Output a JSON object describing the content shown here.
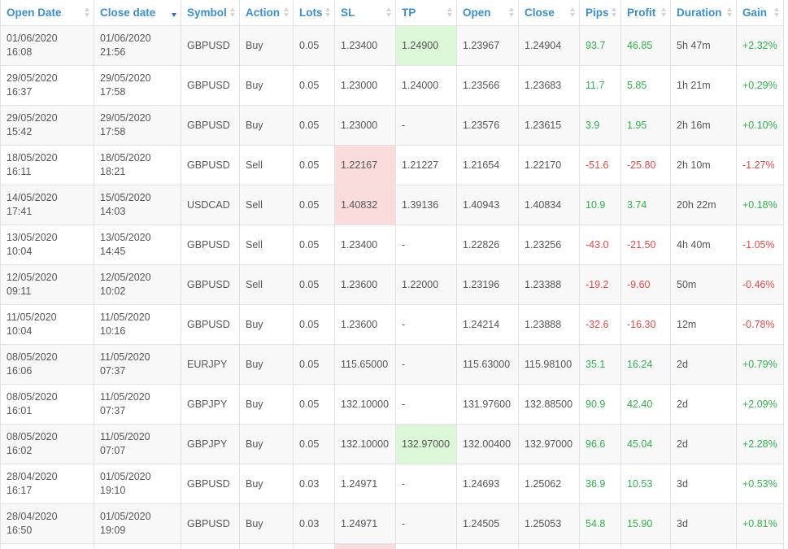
{
  "columns": [
    {
      "label": "Open Date",
      "sort": "none"
    },
    {
      "label": "Close date",
      "sort": "desc"
    },
    {
      "label": "Symbol",
      "sort": "none"
    },
    {
      "label": "Action",
      "sort": "none"
    },
    {
      "label": "Lots",
      "sort": "none"
    },
    {
      "label": "SL",
      "sort": "none"
    },
    {
      "label": "TP",
      "sort": "none"
    },
    {
      "label": "Open",
      "sort": "none"
    },
    {
      "label": "Close",
      "sort": "none"
    },
    {
      "label": "Pips",
      "sort": "none"
    },
    {
      "label": "Profit",
      "sort": "none"
    },
    {
      "label": "Duration",
      "sort": "none"
    },
    {
      "label": "Gain",
      "sort": "none"
    }
  ],
  "colors": {
    "header": "#3a8fd0",
    "positive": "#2eb14a",
    "negative": "#e84848",
    "tp_hit": "#dcf7d8",
    "sl_hit": "#fbdcdc"
  },
  "rows": [
    {
      "open_date": "01/06/2020",
      "open_time": "16:08",
      "close_date": "01/06/2020",
      "close_time": "21:56",
      "symbol": "GBPUSD",
      "action": "Buy",
      "lots": "0.05",
      "sl": "1.23400",
      "tp": "1.24900",
      "open": "1.23967",
      "close": "1.24904",
      "pips": "93.7",
      "profit": "46.85",
      "duration": "5h 47m",
      "gain": "+2.32%",
      "sign": "pos",
      "hit": "tp"
    },
    {
      "open_date": "29/05/2020",
      "open_time": "16:37",
      "close_date": "29/05/2020",
      "close_time": "17:58",
      "symbol": "GBPUSD",
      "action": "Buy",
      "lots": "0.05",
      "sl": "1.23000",
      "tp": "1.24000",
      "open": "1.23566",
      "close": "1.23683",
      "pips": "11.7",
      "profit": "5.85",
      "duration": "1h 21m",
      "gain": "+0.29%",
      "sign": "pos",
      "hit": ""
    },
    {
      "open_date": "29/05/2020",
      "open_time": "15:42",
      "close_date": "29/05/2020",
      "close_time": "17:58",
      "symbol": "GBPUSD",
      "action": "Buy",
      "lots": "0.05",
      "sl": "1.23000",
      "tp": "-",
      "open": "1.23576",
      "close": "1.23615",
      "pips": "3.9",
      "profit": "1.95",
      "duration": "2h 16m",
      "gain": "+0.10%",
      "sign": "pos",
      "hit": ""
    },
    {
      "open_date": "18/05/2020",
      "open_time": "16:11",
      "close_date": "18/05/2020",
      "close_time": "18:21",
      "symbol": "GBPUSD",
      "action": "Sell",
      "lots": "0.05",
      "sl": "1.22167",
      "tp": "1.21227",
      "open": "1.21654",
      "close": "1.22170",
      "pips": "-51.6",
      "profit": "-25.80",
      "duration": "2h 10m",
      "gain": "-1.27%",
      "sign": "neg",
      "hit": "sl"
    },
    {
      "open_date": "14/05/2020",
      "open_time": "17:41",
      "close_date": "15/05/2020",
      "close_time": "14:03",
      "symbol": "USDCAD",
      "action": "Sell",
      "lots": "0.05",
      "sl": "1.40832",
      "tp": "1.39136",
      "open": "1.40943",
      "close": "1.40834",
      "pips": "10.9",
      "profit": "3.74",
      "duration": "20h 22m",
      "gain": "+0.18%",
      "sign": "pos",
      "hit": "sl"
    },
    {
      "open_date": "13/05/2020",
      "open_time": "10:04",
      "close_date": "13/05/2020",
      "close_time": "14:45",
      "symbol": "GBPUSD",
      "action": "Sell",
      "lots": "0.05",
      "sl": "1.23400",
      "tp": "-",
      "open": "1.22826",
      "close": "1.23256",
      "pips": "-43.0",
      "profit": "-21.50",
      "duration": "4h 40m",
      "gain": "-1.05%",
      "sign": "neg",
      "hit": ""
    },
    {
      "open_date": "12/05/2020",
      "open_time": "09:11",
      "close_date": "12/05/2020",
      "close_time": "10:02",
      "symbol": "GBPUSD",
      "action": "Sell",
      "lots": "0.05",
      "sl": "1.23600",
      "tp": "1.22000",
      "open": "1.23196",
      "close": "1.23388",
      "pips": "-19.2",
      "profit": "-9.60",
      "duration": "50m",
      "gain": "-0.46%",
      "sign": "neg",
      "hit": ""
    },
    {
      "open_date": "11/05/2020",
      "open_time": "10:04",
      "close_date": "11/05/2020",
      "close_time": "10:16",
      "symbol": "GBPUSD",
      "action": "Buy",
      "lots": "0.05",
      "sl": "1.23600",
      "tp": "-",
      "open": "1.24214",
      "close": "1.23888",
      "pips": "-32.6",
      "profit": "-16.30",
      "duration": "12m",
      "gain": "-0.78%",
      "sign": "neg",
      "hit": ""
    },
    {
      "open_date": "08/05/2020",
      "open_time": "16:06",
      "close_date": "11/05/2020",
      "close_time": "07:37",
      "symbol": "EURJPY",
      "action": "Buy",
      "lots": "0.05",
      "sl": "115.65000",
      "tp": "-",
      "open": "115.63000",
      "close": "115.98100",
      "pips": "35.1",
      "profit": "16.24",
      "duration": "2d",
      "gain": "+0.79%",
      "sign": "pos",
      "hit": ""
    },
    {
      "open_date": "08/05/2020",
      "open_time": "16:01",
      "close_date": "11/05/2020",
      "close_time": "07:37",
      "symbol": "GBPJPY",
      "action": "Buy",
      "lots": "0.05",
      "sl": "132.10000",
      "tp": "-",
      "open": "131.97600",
      "close": "132.88500",
      "pips": "90.9",
      "profit": "42.40",
      "duration": "2d",
      "gain": "+2.09%",
      "sign": "pos",
      "hit": ""
    },
    {
      "open_date": "08/05/2020",
      "open_time": "16:02",
      "close_date": "11/05/2020",
      "close_time": "07:07",
      "symbol": "GBPJPY",
      "action": "Buy",
      "lots": "0.05",
      "sl": "132.10000",
      "tp": "132.97000",
      "open": "132.00400",
      "close": "132.97000",
      "pips": "96.6",
      "profit": "45.04",
      "duration": "2d",
      "gain": "+2.28%",
      "sign": "pos",
      "hit": "tp"
    },
    {
      "open_date": "28/04/2020",
      "open_time": "16:17",
      "close_date": "01/05/2020",
      "close_time": "19:10",
      "symbol": "GBPUSD",
      "action": "Buy",
      "lots": "0.03",
      "sl": "1.24971",
      "tp": "-",
      "open": "1.24693",
      "close": "1.25062",
      "pips": "36.9",
      "profit": "10.53",
      "duration": "3d",
      "gain": "+0.53%",
      "sign": "pos",
      "hit": ""
    },
    {
      "open_date": "28/04/2020",
      "open_time": "16:50",
      "close_date": "01/05/2020",
      "close_time": "19:09",
      "symbol": "GBPUSD",
      "action": "Buy",
      "lots": "0.03",
      "sl": "1.24971",
      "tp": "-",
      "open": "1.24505",
      "close": "1.25053",
      "pips": "54.8",
      "profit": "15.90",
      "duration": "3d",
      "gain": "+0.81%",
      "sign": "pos",
      "hit": ""
    }
  ]
}
